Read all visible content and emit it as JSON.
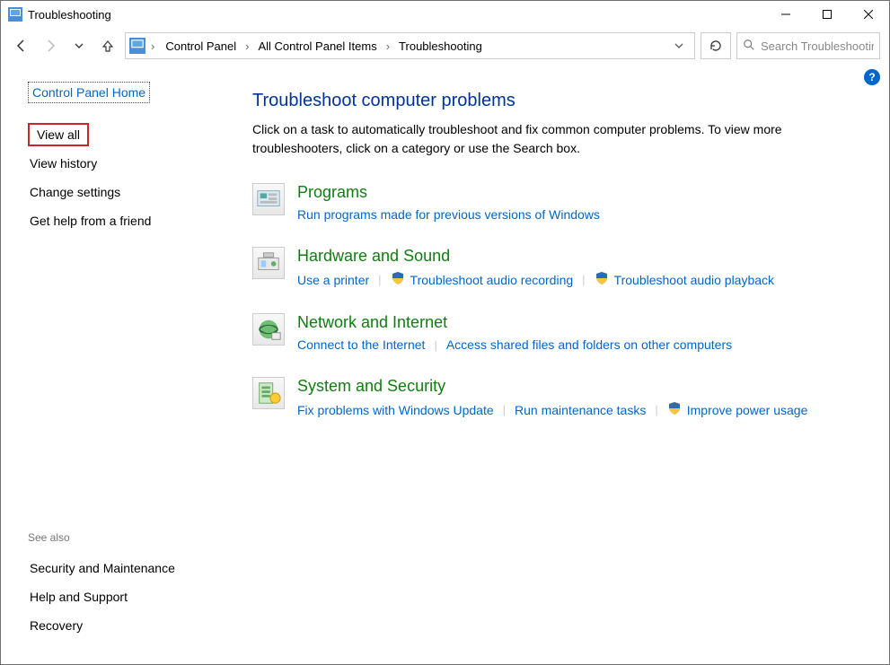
{
  "window": {
    "title": "Troubleshooting"
  },
  "breadcrumb": {
    "items": [
      {
        "label": "Control Panel"
      },
      {
        "label": "All Control Panel Items"
      },
      {
        "label": "Troubleshooting"
      }
    ]
  },
  "search": {
    "placeholder": "Search Troubleshooting"
  },
  "sidebar": {
    "home": "Control Panel Home",
    "items": [
      {
        "label": "View all",
        "highlighted": true
      },
      {
        "label": "View history"
      },
      {
        "label": "Change settings"
      },
      {
        "label": "Get help from a friend"
      }
    ],
    "seealso_header": "See also",
    "seealso": [
      {
        "label": "Security and Maintenance"
      },
      {
        "label": "Help and Support"
      },
      {
        "label": "Recovery"
      }
    ]
  },
  "main": {
    "heading": "Troubleshoot computer problems",
    "intro": "Click on a task to automatically troubleshoot and fix common computer problems. To view more troubleshooters, click on a category or use the Search box.",
    "categories": [
      {
        "title": "Programs",
        "icon": "programs",
        "links": [
          {
            "label": "Run programs made for previous versions of Windows",
            "shield": false
          }
        ]
      },
      {
        "title": "Hardware and Sound",
        "icon": "hardware",
        "links": [
          {
            "label": "Use a printer",
            "shield": false
          },
          {
            "label": "Troubleshoot audio recording",
            "shield": true
          },
          {
            "label": "Troubleshoot audio playback",
            "shield": true
          }
        ]
      },
      {
        "title": "Network and Internet",
        "icon": "network",
        "links": [
          {
            "label": "Connect to the Internet",
            "shield": false
          },
          {
            "label": "Access shared files and folders on other computers",
            "shield": false
          }
        ]
      },
      {
        "title": "System and Security",
        "icon": "system",
        "links": [
          {
            "label": "Fix problems with Windows Update",
            "shield": false
          },
          {
            "label": "Run maintenance tasks",
            "shield": false
          },
          {
            "label": "Improve power usage",
            "shield": true
          }
        ]
      }
    ]
  }
}
